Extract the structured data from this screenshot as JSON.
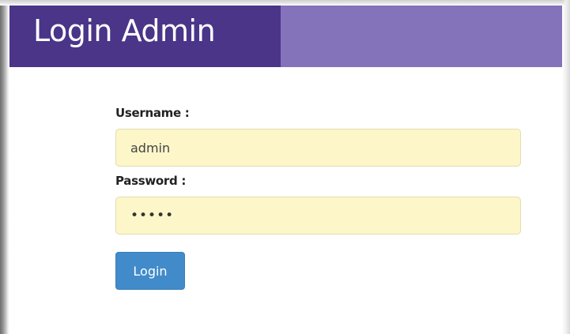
{
  "header": {
    "title": "Login Admin",
    "title_bg_color": "#4a3589",
    "bar_bg_color": "#8472ba"
  },
  "form": {
    "username": {
      "label": "Username :",
      "value": "admin"
    },
    "password": {
      "label": "Password :",
      "value": "admin"
    },
    "input_bg_color": "#fcf6c9",
    "submit_label": "Login",
    "submit_color": "#428bca"
  }
}
